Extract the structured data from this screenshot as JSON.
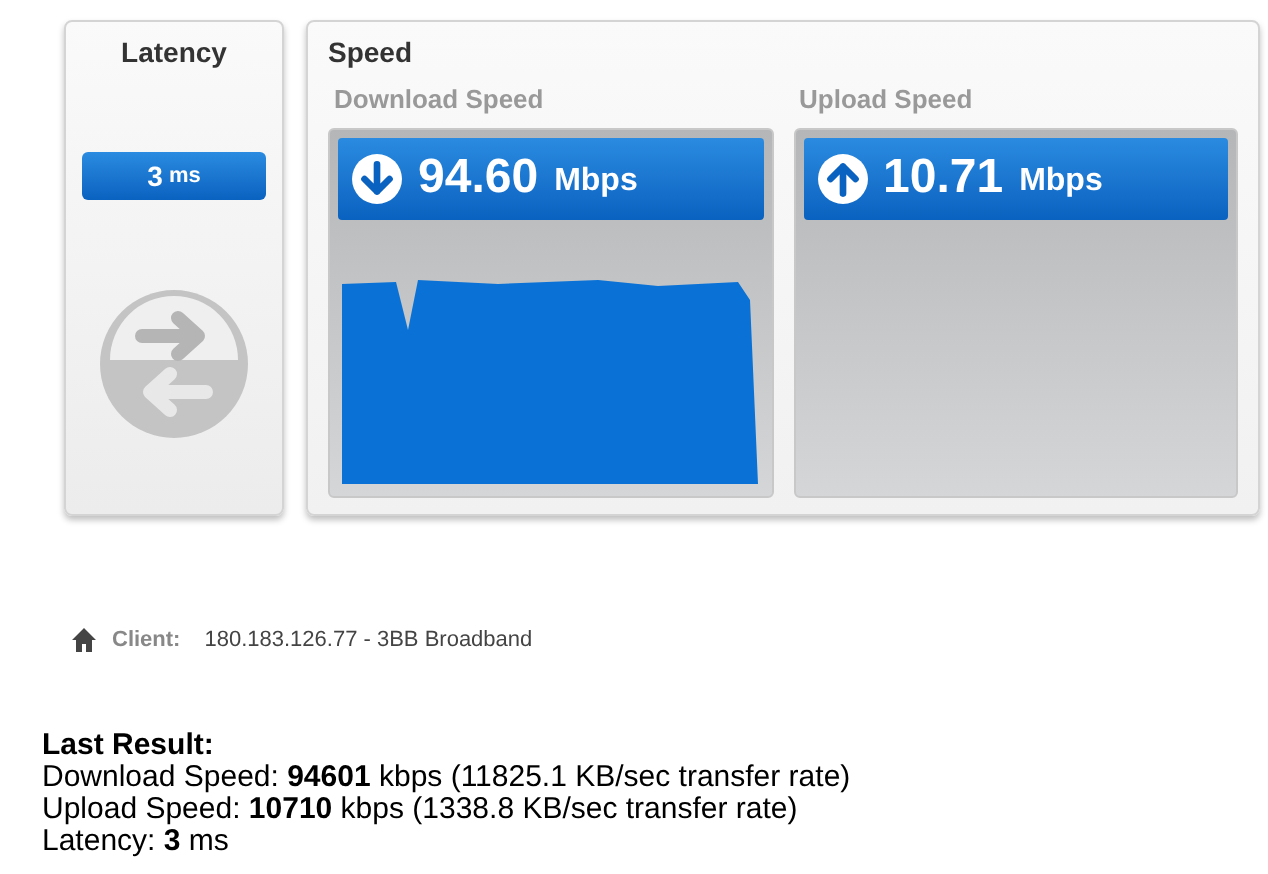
{
  "latency": {
    "title": "Latency",
    "value": "3",
    "unit": "ms"
  },
  "speed": {
    "title": "Speed",
    "meters": [
      {
        "kind": "download",
        "label": "Download Speed",
        "value": "94.60",
        "unit": "Mbps",
        "graph": true
      },
      {
        "kind": "upload",
        "label": "Upload Speed",
        "value": "10.71",
        "unit": "Mbps",
        "graph": false
      }
    ]
  },
  "client": {
    "label": "Client:",
    "value": "180.183.126.77 - 3BB Broadband"
  },
  "last_result": {
    "title": "Last Result:",
    "lines": [
      "Download Speed: **94601** kbps (11825.1 KB/sec transfer rate)",
      "Upload Speed: **10710** kbps (1338.8 KB/sec transfer rate)",
      "Latency: **3** ms"
    ]
  }
}
